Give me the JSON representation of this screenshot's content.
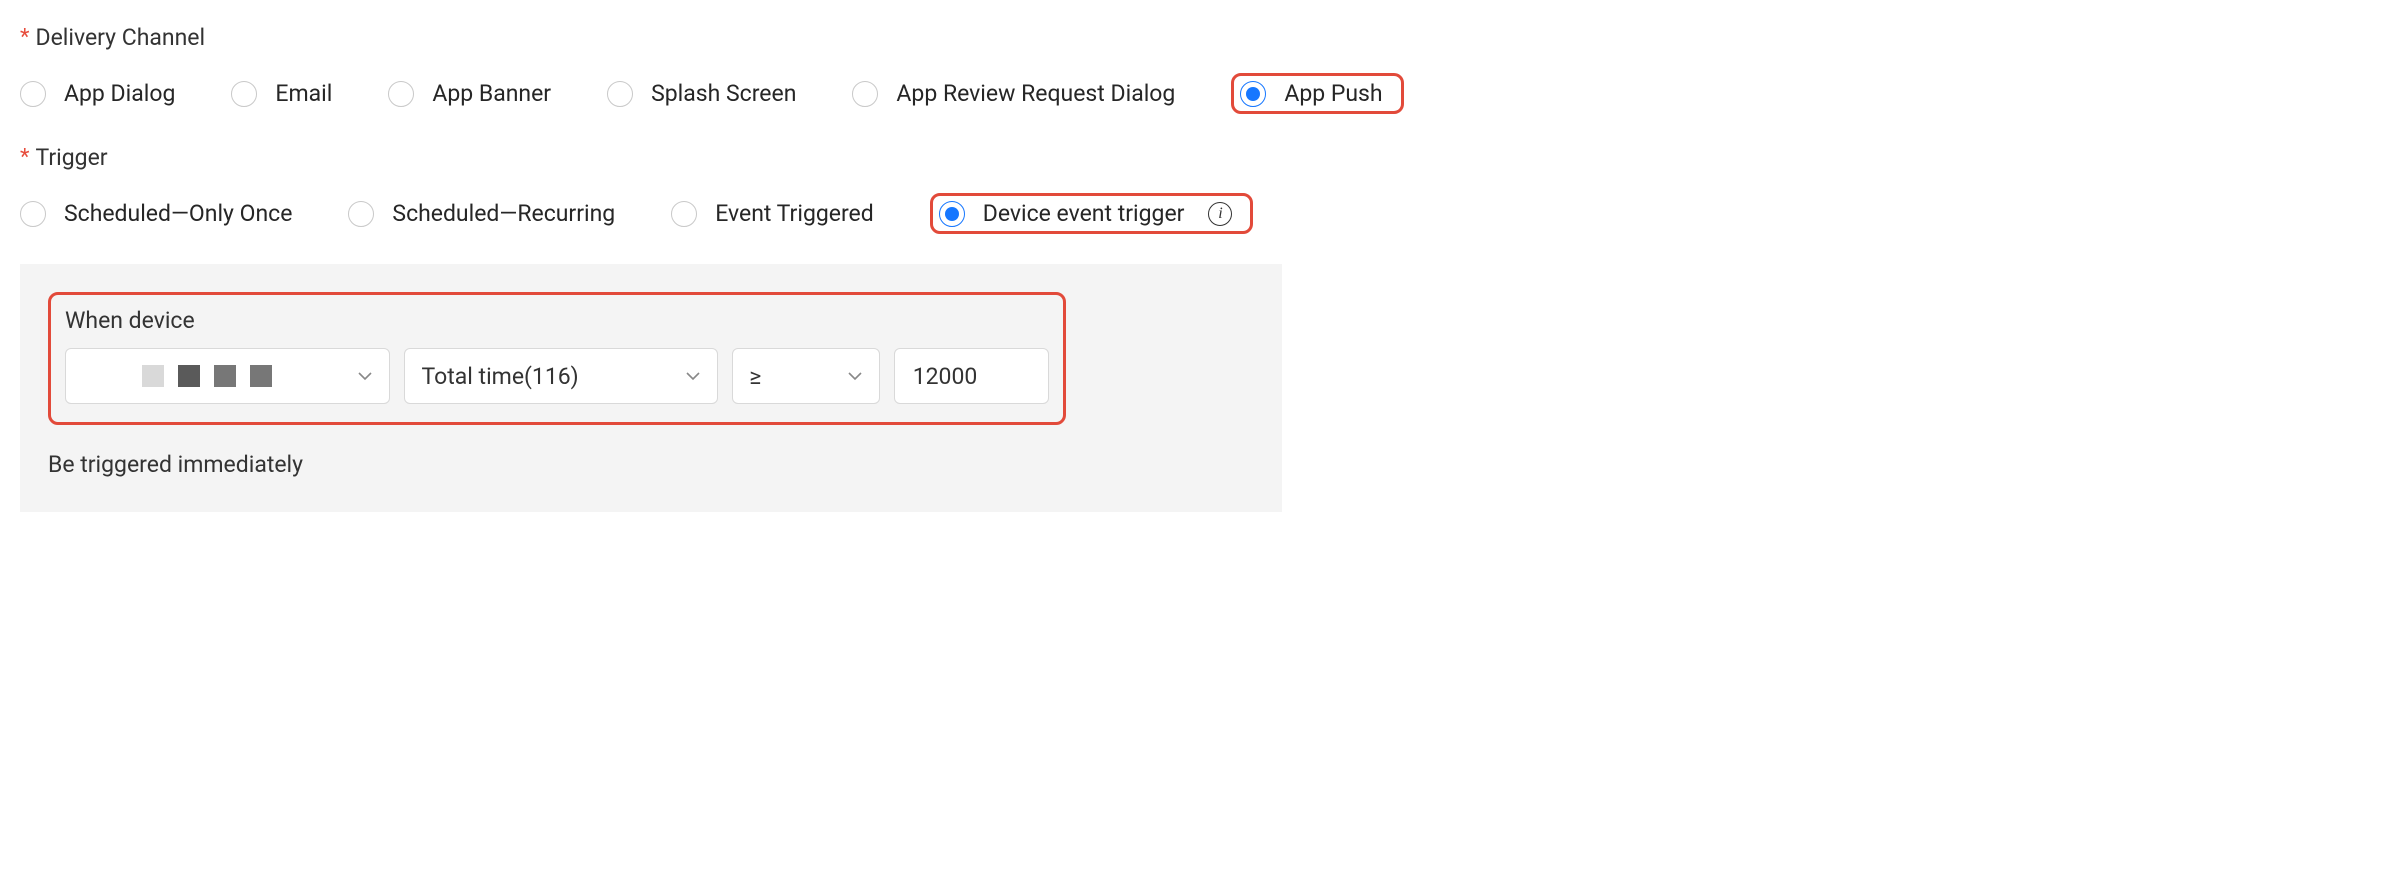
{
  "fields": {
    "delivery": {
      "label": "Delivery Channel",
      "options": {
        "app_dialog": "App Dialog",
        "email": "Email",
        "app_banner": "App Banner",
        "splash_screen": "Splash Screen",
        "app_review": "App Review Request Dialog",
        "app_push": "App Push"
      },
      "selected": "app_push"
    },
    "trigger": {
      "label": "Trigger",
      "options": {
        "once": "Scheduled—Only Once",
        "recurring": "Scheduled—Recurring",
        "event": "Event Triggered",
        "device": "Device event trigger"
      },
      "selected": "device"
    }
  },
  "condition": {
    "title": "When device",
    "device_select": "",
    "metric_select": "Total time(116)",
    "operator_select": "≥",
    "value_input": "12000",
    "footer": "Be triggered immediately"
  }
}
